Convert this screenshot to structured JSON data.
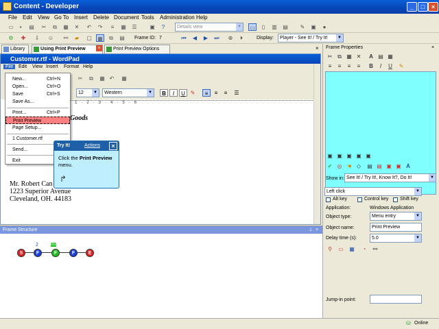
{
  "window": {
    "title": "Content - Developer"
  },
  "menubar": [
    "File",
    "Edit",
    "View",
    "Go To",
    "Insert",
    "Delete",
    "Document",
    "Tools",
    "Administration",
    "Help"
  ],
  "toolbar": {
    "view_combo": "Details view",
    "frame_id_label": "Frame ID:",
    "frame_id_value": "7",
    "display_label": "Display:",
    "display_value": "Player - See It! / Try It!"
  },
  "tabs": [
    "Library",
    "Using Print Preview",
    "Print Preview Options"
  ],
  "frame_properties_title": "Frame Properties",
  "wordpad": {
    "title": "Customer.rtf - WordPad",
    "menu": [
      "File",
      "Edit",
      "View",
      "Insert",
      "Format",
      "Help"
    ],
    "font_size": "12",
    "script": "Western"
  },
  "file_menu": {
    "items": [
      {
        "label": "New...",
        "shortcut": "Ctrl+N"
      },
      {
        "label": "Open...",
        "shortcut": "Ctrl+O"
      },
      {
        "label": "Save",
        "shortcut": "Ctrl+S"
      },
      {
        "label": "Save As...",
        "shortcut": ""
      },
      {
        "label": "Print...",
        "shortcut": "Ctrl+P"
      },
      {
        "label": "Print Preview",
        "shortcut": ""
      },
      {
        "label": "Page Setup...",
        "shortcut": ""
      },
      {
        "label": "1 Customer.rtf",
        "shortcut": ""
      },
      {
        "label": "Send...",
        "shortcut": ""
      },
      {
        "label": "Exit",
        "shortcut": ""
      }
    ]
  },
  "document": {
    "heading": "Goods",
    "lines": [
      "Mr. Robert Can",
      "1223 Superior Avenue",
      "Cleveland, OH. 44183"
    ]
  },
  "callout": {
    "header": "Try It!",
    "actions": "Actions",
    "text_prefix": "Click the ",
    "text_bold": "Print Preview",
    "text_suffix": " menu."
  },
  "frame_structure": {
    "title": "Frame Structure",
    "nodes": [
      "S",
      "F",
      "F",
      "F",
      "E"
    ],
    "labels": [
      "",
      "2",
      "0/2",
      "",
      ""
    ]
  },
  "properties": {
    "show_in_label": "Show in:",
    "show_in_value": "See It! / Try It!, Know It?, Do It!",
    "action_value": "Left click",
    "alt_key": "Alt key",
    "control_key": "Control key",
    "shift_key": "Shift key",
    "application_label": "Application:",
    "application_value": "Windows Application",
    "object_type_label": "Object type:",
    "object_type_value": "Menu entry",
    "object_name_label": "Object name:",
    "object_name_value": "Print Preview",
    "delay_label": "Delay time (s):",
    "delay_value": "5.0",
    "jump_in_label": "Jump-in point:"
  },
  "status": {
    "online": "Online"
  }
}
